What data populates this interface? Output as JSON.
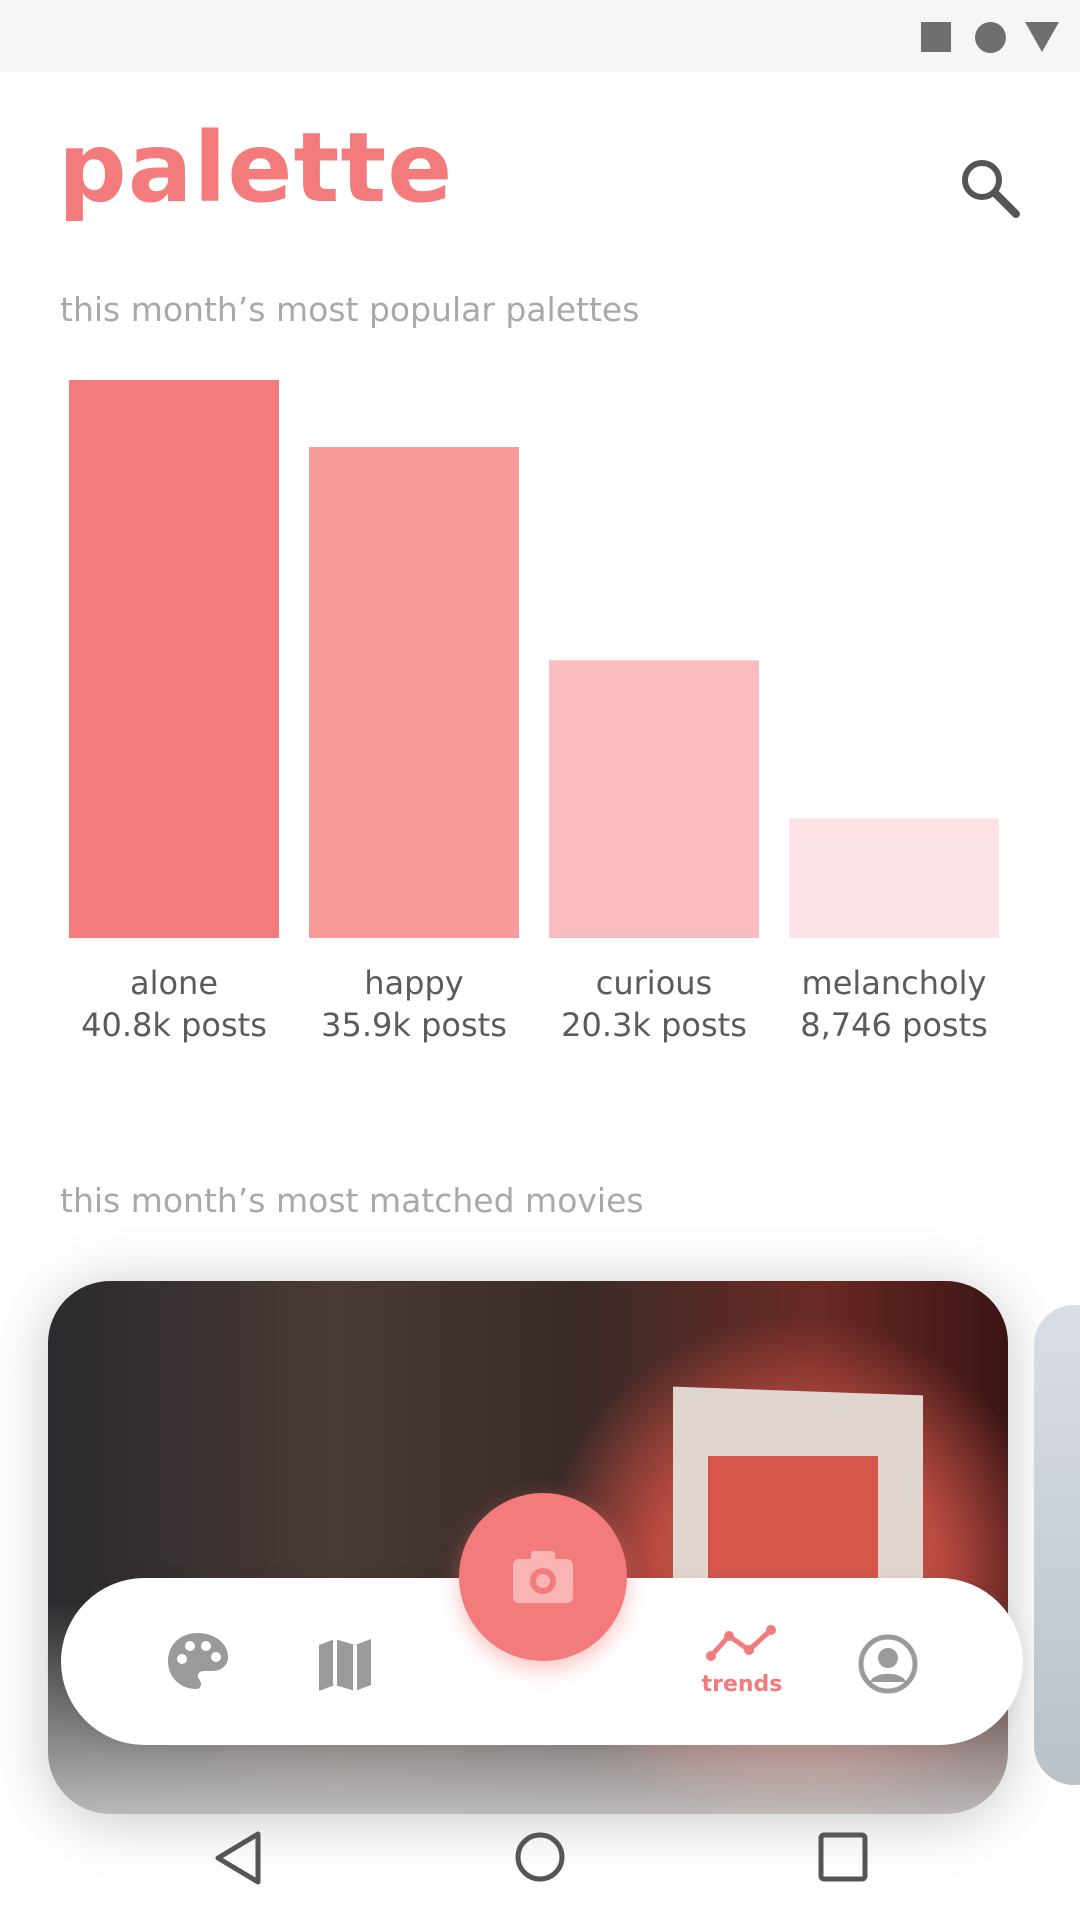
{
  "app": {
    "title": "palette"
  },
  "sections": {
    "palettes_title": "this month’s most popular palettes",
    "movies_title": "this month’s most matched movies"
  },
  "colors": {
    "accent": "#f47b7b",
    "bars": [
      "#f47b7b",
      "#fa9b9b",
      "#fbbcbd",
      "#fde3e5"
    ],
    "icon_grey": "#9a9a9a"
  },
  "chart_data": {
    "type": "bar",
    "categories": [
      "alone",
      "happy",
      "curious",
      "melancholy"
    ],
    "values": [
      40.8,
      35.9,
      20.3,
      8.746
    ],
    "value_labels": [
      "40.8k posts",
      "35.9k posts",
      "20.3k posts",
      "8,746 posts"
    ],
    "title": "this month’s most popular palettes",
    "xlabel": "",
    "ylabel": "",
    "grid": false
  },
  "nav": {
    "trends_label": "trends",
    "items": [
      "palette-icon",
      "map-icon",
      "camera-icon",
      "trends-icon",
      "account-icon"
    ],
    "active": "trends"
  },
  "icons": {
    "search": "search-icon",
    "system": [
      "back-icon",
      "home-icon",
      "recents-icon"
    ]
  }
}
